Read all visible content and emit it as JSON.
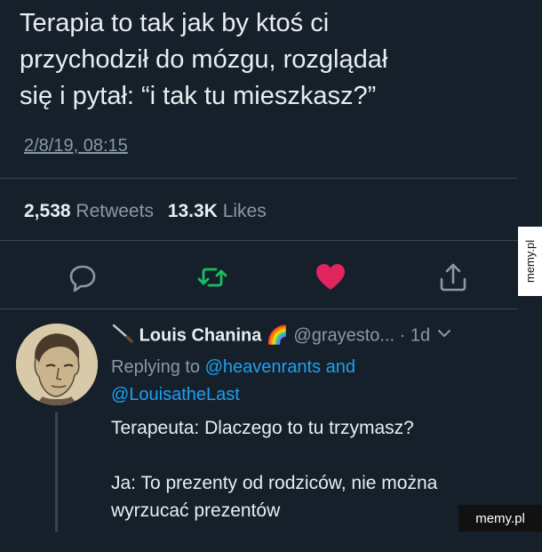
{
  "tweet": {
    "text": "Terapia to tak jak by ktoś ci\nprzychodził do mózgu, rozglądał\nsię i pytał: “i tak tu mieszkasz?”",
    "timestamp": "2/8/19, 08:15",
    "retweets_count": "2,538",
    "retweets_label": "Retweets",
    "likes_count": "13.3K",
    "likes_label": "Likes"
  },
  "actions": [
    {
      "icon": "reply-icon"
    },
    {
      "icon": "retweet-icon",
      "color": "#17bf63"
    },
    {
      "icon": "heart-icon",
      "color": "#e0245e"
    },
    {
      "icon": "share-icon"
    }
  ],
  "reply": {
    "display_name": "Louis Chanina",
    "emoji": "🌈",
    "handle": "@grayesto...",
    "separator": "·",
    "time": "1d",
    "replying_prefix": "Replying to",
    "replying_user1": "@heavenrants",
    "replying_and": "and",
    "replying_user2": "@LouisatheLast",
    "line1": "Terapeuta: Dlaczego to tu trzymasz?",
    "line2": "Ja: To prezenty od rodziców, nie można wyrzucać prezentów"
  },
  "watermarks": {
    "side": "memy.pl",
    "corner": "memy.pl"
  },
  "colors": {
    "background": "#15202b",
    "divider": "#38444d",
    "muted_text": "#8899a6",
    "link": "#1da1f2",
    "retweet_green": "#17bf63",
    "like_red": "#e0245e"
  }
}
